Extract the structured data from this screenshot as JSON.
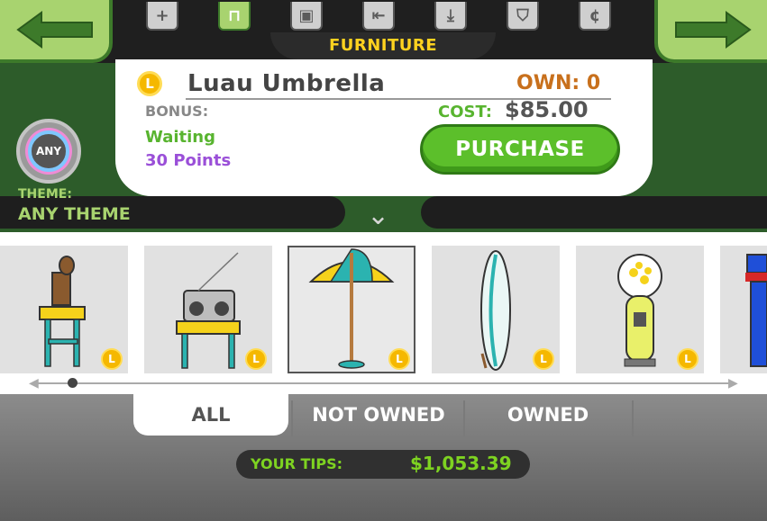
{
  "category": "FURNITURE",
  "category_tabs": [
    {
      "icon": "plus-icon",
      "glyph": "+",
      "active": false
    },
    {
      "icon": "table-icon",
      "glyph": "⊓",
      "active": true
    },
    {
      "icon": "picture-icon",
      "glyph": "▣",
      "active": false
    },
    {
      "icon": "wall-icon",
      "glyph": "⇤",
      "active": false
    },
    {
      "icon": "floor-icon",
      "glyph": "⤓",
      "active": false
    },
    {
      "icon": "shirt-icon",
      "glyph": "⛉",
      "active": false
    },
    {
      "icon": "coin-c-icon",
      "glyph": "¢",
      "active": false
    }
  ],
  "item": {
    "name": "Luau Umbrella",
    "own": "OWN: 0",
    "bonus_label": "BONUS:",
    "bonus_status": "Waiting",
    "bonus_points": "30 Points",
    "cost_label": "COST:",
    "cost_value": "$85.00",
    "purchase_label": "PURCHASE"
  },
  "theme": {
    "badge": "ANY",
    "label": "THEME:",
    "value": "ANY THEME"
  },
  "coin_glyph": "L",
  "items": [
    {
      "name": "tiki-table-item",
      "selected": false
    },
    {
      "name": "boombox-table-item",
      "selected": false
    },
    {
      "name": "luau-umbrella-item",
      "selected": true
    },
    {
      "name": "surfboard-item",
      "selected": false
    },
    {
      "name": "gumball-machine-item",
      "selected": false
    },
    {
      "name": "blue-booth-item",
      "selected": false
    }
  ],
  "scroll_position": 0.05,
  "filter_tabs": [
    {
      "label": "ALL",
      "active": true
    },
    {
      "label": "NOT OWNED",
      "active": false
    },
    {
      "label": "OWNED",
      "active": false
    }
  ],
  "tips": {
    "label": "YOUR TIPS:",
    "value": "$1,053.39"
  },
  "colors": {
    "accent_green": "#5cbf2b",
    "panel_green": "#2d5c2a",
    "coin_gold": "#f5b800",
    "own_orange": "#c8701c",
    "points_purple": "#9a4fd8"
  }
}
